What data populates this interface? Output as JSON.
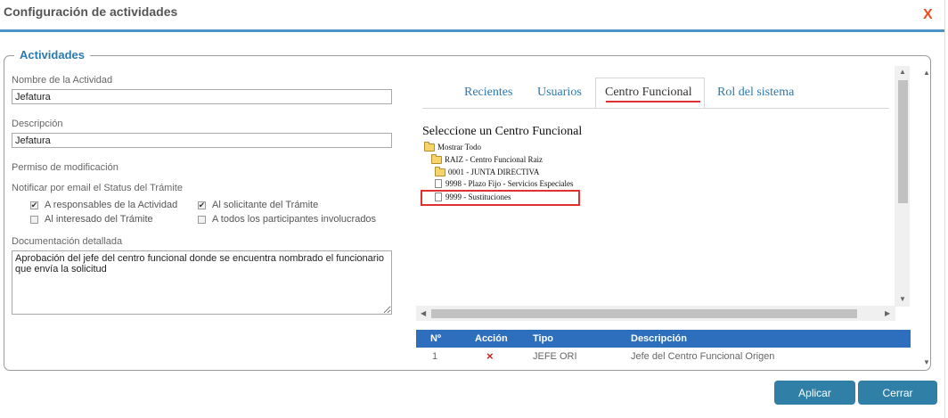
{
  "dialog": {
    "title": "Configuración de actividades",
    "close_label": "X",
    "accent_color": "#4d93c8"
  },
  "form": {
    "legend": "Actividades",
    "nombre_label": "Nombre de la Actividad",
    "nombre_value": "Jefatura",
    "descripcion_label": "Descripción",
    "descripcion_value": "Jefatura",
    "permiso_label": "Permiso de modificación",
    "notificar_label": "Notificar por email el Status del Trámite",
    "checks": [
      {
        "label": "A responsables de la Actividad",
        "checked": true
      },
      {
        "label": "Al solicitante del Trámite",
        "checked": true
      },
      {
        "label": "Al interesado del Trámite",
        "checked": false
      },
      {
        "label": "A todos los participantes involucrados",
        "checked": false
      }
    ],
    "doc_label": "Documentación detallada",
    "doc_value": "Aprobación del jefe del centro funcional donde se encuentra nombrado el funcionario que envía la solicitud"
  },
  "tabs": [
    {
      "label": "Recientes",
      "active": false
    },
    {
      "label": "Usuarios",
      "active": false
    },
    {
      "label": "Centro Funcional",
      "active": true
    },
    {
      "label": "Rol del sistema",
      "active": false
    }
  ],
  "tree": {
    "title": "Seleccione un Centro Funcional",
    "nodes": [
      {
        "label": "Mostrar Todo",
        "icon": "folder-icon"
      },
      {
        "label": "RAIZ - Centro Funcional Raiz",
        "icon": "folder-icon"
      },
      {
        "label": "0001 - JUNTA DIRECTIVA",
        "icon": "folder-icon"
      },
      {
        "label": "9998 - Plazo Fijo - Servicios Especiales",
        "icon": "document-icon"
      },
      {
        "label": "9999 - Sustituciones",
        "icon": "document-icon"
      }
    ]
  },
  "grid": {
    "columns": [
      "Nº",
      "Acción",
      "Tipo",
      "Descripción"
    ],
    "rows": [
      {
        "n": "1",
        "accion": "×",
        "tipo": "JEFE ORI",
        "descripcion": "Jefe del Centro Funcional Origen"
      }
    ],
    "header_color": "#2d6fbd"
  },
  "buttons": {
    "apply": "Aplicar",
    "close": "Cerrar"
  }
}
